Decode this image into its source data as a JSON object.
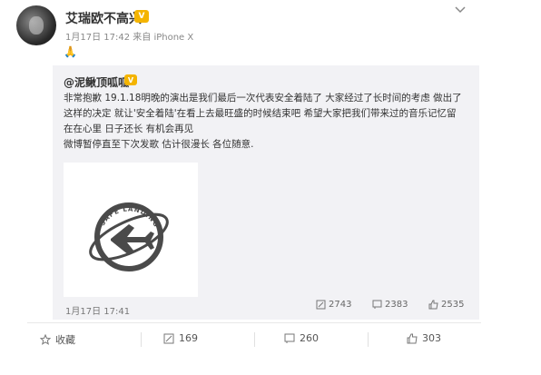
{
  "post": {
    "username": "艾瑞欧不高兴",
    "meta": "1月17日 17:42 来自 iPhone X",
    "content_emoji": "🙏"
  },
  "repost": {
    "author": "@泥鳅顶呱呱",
    "text_lines": [
      "非常抱歉 19.1.18明晚的演出是我们最后一次代表安全着陆了 大家经过了长时间的考虑 做出了",
      "这样的决定 就让'安全着陆'在看上去最旺盛的时候结束吧 希望大家把我们带来过的音乐记忆留",
      "在在心里 日子还长 有机会再见",
      "微博暂停直至下次发歌 估计很漫长 各位随意."
    ],
    "image_logo_text": "SAFE LANDING",
    "time": "1月17日 17:41",
    "reposts": "2743",
    "comments": "2383",
    "likes": "2535"
  },
  "footer": {
    "favorite_label": "收藏",
    "repost_count": "169",
    "comment_count": "260",
    "like_count": "303"
  },
  "colors": {
    "badge": "#f4b400",
    "panel": "#f2f2f5"
  }
}
